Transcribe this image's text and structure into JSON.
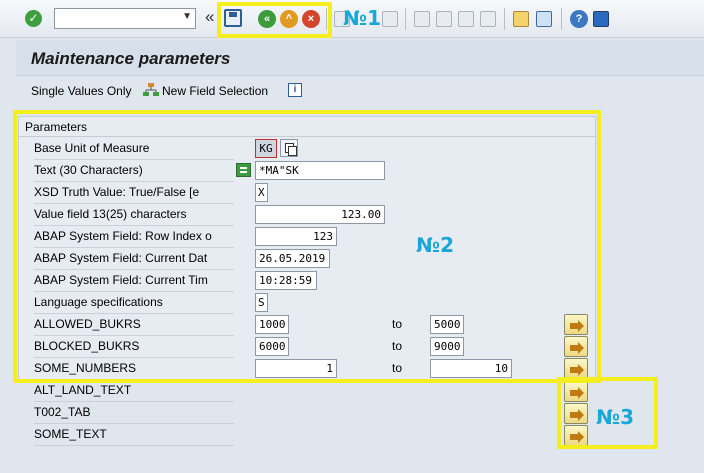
{
  "toolbar": {
    "command_value": "",
    "anno1": "№1"
  },
  "title": "Maintenance parameters",
  "app_toolbar": {
    "single_values": "Single Values Only",
    "new_field_selection": "New Field Selection"
  },
  "group_title": "Parameters",
  "rows": [
    {
      "label": "Base Unit of Measure",
      "value": "KG"
    },
    {
      "label": "Text (30 Characters)",
      "value": "*MA\"SK"
    },
    {
      "label": "XSD Truth Value: True/False [e",
      "value": "X"
    },
    {
      "label": "Value field 13(25) characters",
      "value": "123.00"
    },
    {
      "label": "ABAP System Field: Row Index o",
      "value": "123"
    },
    {
      "label": "ABAP System Field: Current Dat",
      "value": "26.05.2019"
    },
    {
      "label": "ABAP System Field: Current Tim",
      "value": "10:28:59"
    },
    {
      "label": "Language specifications",
      "value": "S"
    },
    {
      "label": "ALLOWED_BUKRS",
      "from": "1000",
      "to_label": "to",
      "to": "5000"
    },
    {
      "label": "BLOCKED_BUKRS",
      "from": "6000",
      "to_label": "to",
      "to": "9000"
    },
    {
      "label": "SOME_NUMBERS",
      "from": "1",
      "to_label": "to",
      "to": "10"
    },
    {
      "label": "ALT_LAND_TEXT"
    },
    {
      "label": "T002_TAB"
    },
    {
      "label": "SOME_TEXT"
    }
  ],
  "annotations": {
    "n2": "№2",
    "n3": "№3"
  }
}
